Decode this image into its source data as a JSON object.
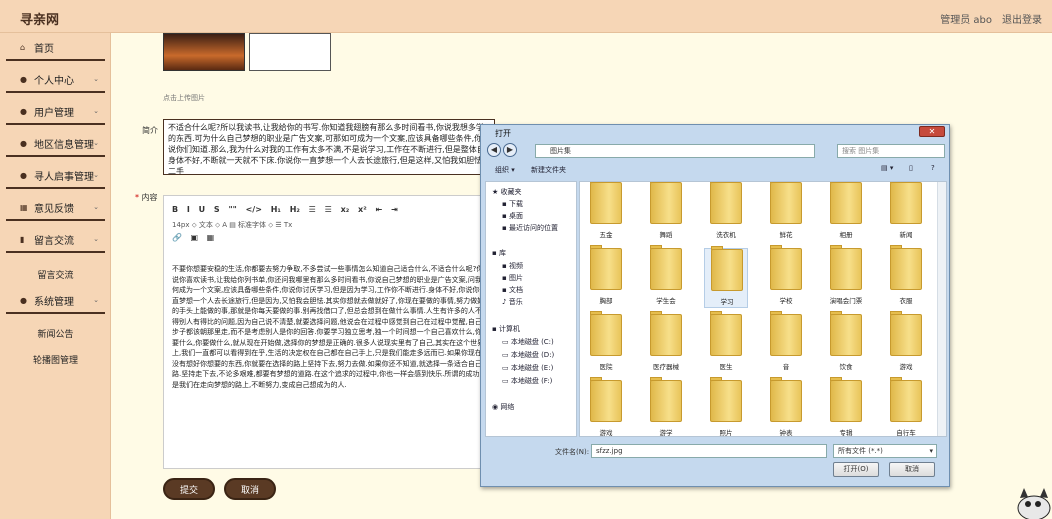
{
  "app": {
    "brand": "寻亲网",
    "admin": "管理员 abo",
    "logout": "退出登录"
  },
  "sidebar": {
    "items": [
      {
        "label": "首页",
        "icon": "home-icon",
        "chev": ""
      },
      {
        "label": "个人中心",
        "icon": "user-icon",
        "chev": "⌄"
      },
      {
        "label": "用户管理",
        "icon": "user-icon",
        "chev": "⌄"
      },
      {
        "label": "地区信息管理",
        "icon": "user-icon",
        "chev": "⌄"
      },
      {
        "label": "寻人启事管理",
        "icon": "user-icon",
        "chev": "⌄"
      },
      {
        "label": "意见反馈",
        "icon": "grid-icon",
        "chev": "⌄"
      },
      {
        "label": "留言交流",
        "icon": "chart-icon",
        "chev": "⌄"
      }
    ],
    "sub_liuyan": "留言交流",
    "system": {
      "label": "系统管理",
      "chev": "⌄"
    },
    "sub_system": [
      "新闻公告",
      "轮播图管理"
    ]
  },
  "form": {
    "upload_hint": "点击上传图片",
    "intro_label": "简介",
    "intro_text": "不适合什么呢?所以我读书,让我给你的书写.你知道我翅膀有那么多时间看书,你说我想多学的东西.可为什么自己梦想的职业是广告文案,可那如可成为一个文案,应该具备哪些条件,你说你们知道.那么,我为什么对我的工作有太多不满,不是说学习,工作在不断进行,但是整体自身体不好,不断就一天就不下床.你说你一直梦想一个人去长途旅行,但是这样,又怕我如胆怯.二手",
    "content_label": "内容",
    "toolbar1": "B I U S  \"\" </>  H₁ H₂  ☰ ☰  x₂ x²  ⇤ ⇥",
    "toolbar2": "14px ⬦   文本 ⬦   A ▤   标准字体 ⬦   ☰   Tx",
    "toolbar3": "🔗 ▣ ▦",
    "content_text": "不要你想要安稳的生活,你都要去努力争取,不多尝试一些事情怎么知道自己适合什么,不适合什么呢?你说你喜欢读书,让我给你列书单,你还问我哪里有那么多时间看书,你说自己梦想的职业是广告文案,问我如何成为一个文案,应该具备哪些条件,你说你讨厌学习,但是因为学习,工作你不断进行.身体不好,你说你一直梦想一个人去长途旅行,但是因为,又怕我会胆怯.其实你想就去做就好了,你现在要做的事情,努力做好的手头上能做的事,那就是你每天要做的事.别再找借口了,但总会想到在做什么事情.人生有许多的人不懂得别人有得比的问题,因为自己说不清楚,就要选择问题,他说会在过程中感觉到自己在过程中觉醒,自己的步子都该朝那里走,而不是考虑别人是你的回答.你要学习独立思考,独一个时间想一个自己喜欢什么,你想要什么,你要做什么,就从现在开始做,选择你的梦想是正确的.很多人说现实里有了自己,其实在这个世界上,我们一直都可以看得到在乎,生活的决定权在自己都在自己手上,只是我们能走多远而已.如果你现在还没有想好你想要的东西,你就要在选择的路上坚持下去,努力去做.如果你还不知道,就选择一条适合自己的路.坚持走下去,不论多艰难,都要有梦想的道路.在这个追求的过程中,你也一样会感到快乐.所谓的成功,就是我们在走向梦想的路上,不断努力,变成自己想成为的人.",
    "submit": "提交",
    "cancel": "取消"
  },
  "dialog": {
    "title": "打开",
    "close": "✕",
    "address": "图片集",
    "search_placeholder": "搜索 图片集",
    "organize": "组织 ▾",
    "new_folder": "新建文件夹",
    "nav": [
      "收藏夹",
      "下载",
      "桌面",
      "最近访问的位置",
      "库",
      "视频",
      "图片",
      "文档",
      "音乐",
      "计算机",
      "本地磁盘 (C:)",
      "本地磁盘 (D:)",
      "本地磁盘 (E:)",
      "本地磁盘 (F:)",
      "网络"
    ],
    "folders": [
      "五金",
      "舞蹈",
      "洗衣机",
      "鲜花",
      "相册",
      "新闻",
      "胸部",
      "学生会",
      "学习",
      "学校",
      "演唱会门票",
      "衣服",
      "医院",
      "医疗器械",
      "医生",
      "音",
      "饮食",
      "游戏",
      "游戏",
      "游学",
      "照片",
      "钟表",
      "专辑",
      "自行车"
    ],
    "filename_label": "文件名(N):",
    "filename": "sfzz.jpg",
    "filetype": "所有文件 (*.*)",
    "open": "打开(O)",
    "cancel": "取消"
  }
}
